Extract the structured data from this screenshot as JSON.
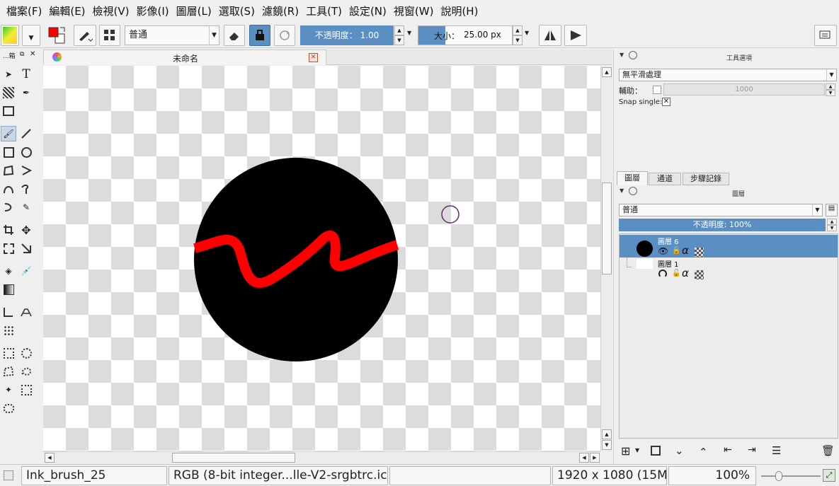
{
  "menu": [
    "檔案(F)",
    "編輯(E)",
    "檢視(V)",
    "影像(I)",
    "圖層(L)",
    "選取(S)",
    "濾鏡(R)",
    "工具(T)",
    "設定(N)",
    "視窗(W)",
    "說明(H)"
  ],
  "toolbar": {
    "blend_mode": "普通",
    "opacity_label": "不透明度：",
    "opacity_value": "1.00",
    "size_label": "大小：",
    "size_value": "25.00 px"
  },
  "toolbox_title": "...箱",
  "document_tab": "未命名",
  "tool_options": {
    "title": "工具選項",
    "smoothing": "無平滑處理",
    "assist_label": "輔助：",
    "assist_value": "1000",
    "snap_single_label": "Snap single:"
  },
  "dock_tabs": [
    "圖層",
    "通道",
    "步驟記錄"
  ],
  "layers_panel": {
    "title": "圖層",
    "blend_mode": "普通",
    "opacity_text": "不透明度:  100%",
    "layers": [
      {
        "name": "圖層 6",
        "selected": true
      },
      {
        "name": "圖層 1",
        "selected": false
      }
    ]
  },
  "status": {
    "brush": "Ink_brush_25",
    "color_space": "RGB (8-bit integer...lle-V2-srgbtrc.icc",
    "dimensions": "1920 x 1080 (15M)",
    "zoom": "100%"
  },
  "colors": {
    "accent": "#5b8fc4",
    "selection": "#5b8fc4",
    "stroke": "#ff0000",
    "fill": "#000000"
  }
}
